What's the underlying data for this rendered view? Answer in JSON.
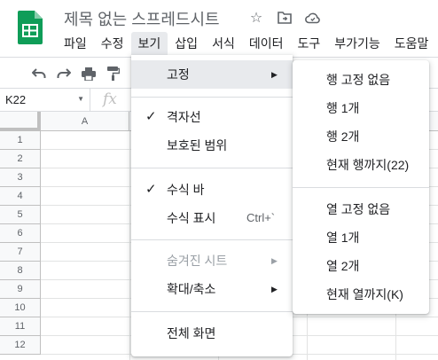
{
  "doc": {
    "title": "제목 없는 스프레드시트"
  },
  "menubar": [
    "파일",
    "수정",
    "보기",
    "삽입",
    "서식",
    "데이터",
    "도구",
    "부가기능",
    "도움말"
  ],
  "formula_bar": {
    "name_box": "K22",
    "fx_label": "fx"
  },
  "grid": {
    "columns": [
      "A"
    ],
    "rows": [
      "1",
      "2",
      "3",
      "4",
      "5",
      "6",
      "7",
      "8",
      "9",
      "10",
      "11",
      "12"
    ]
  },
  "view_menu": {
    "freeze": "고정",
    "gridlines": "격자선",
    "protected_ranges": "보호된 범위",
    "formula_bar": "수식 바",
    "show_formulas": "수식 표시",
    "show_formulas_shortcut": "Ctrl+`",
    "hidden_sheets": "숨겨진 시트",
    "zoom": "확대/축소",
    "full_screen": "전체 화면"
  },
  "freeze_submenu": {
    "no_rows": "행 고정 없음",
    "one_row": "행 1개",
    "two_rows": "행 2개",
    "up_to_row": "현재 행까지(22)",
    "no_columns": "열 고정 없음",
    "one_col": "열 1개",
    "two_cols": "열 2개",
    "up_to_col": "현재 열까지(K)"
  },
  "icons": {
    "logo": "sheets-logo",
    "star": "star-icon",
    "move": "move-to-folder-icon",
    "cloud": "cloud-status-icon",
    "undo": "undo-icon",
    "redo": "redo-icon",
    "print": "print-icon",
    "paint": "paint-format-icon"
  },
  "colors": {
    "brand": "#0F9D58",
    "menu_highlight": "#e8eaed"
  }
}
